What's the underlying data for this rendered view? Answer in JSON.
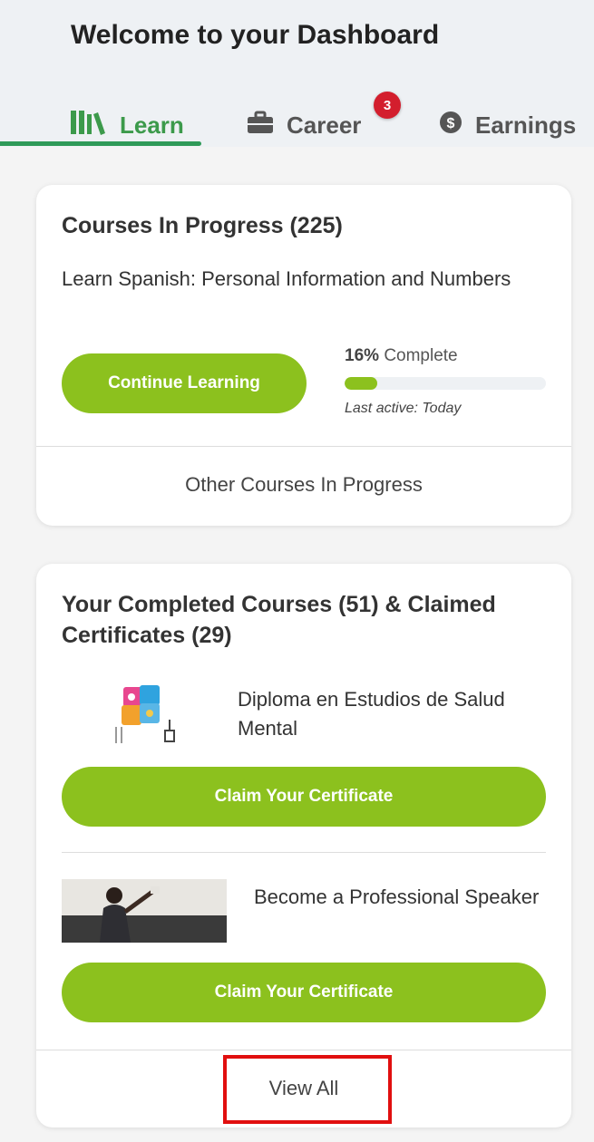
{
  "header": {
    "title": "Welcome to your Dashboard",
    "tabs": [
      {
        "label": "Learn",
        "icon": "books-icon",
        "active": true
      },
      {
        "label": "Career",
        "icon": "briefcase-icon",
        "badge": "3"
      },
      {
        "label": "Earnings",
        "icon": "dollar-coin-icon"
      }
    ]
  },
  "in_progress": {
    "title": "Courses In Progress (225)",
    "course_name": "Learn Spanish: Personal Information and Numbers",
    "continue_label": "Continue Learning",
    "progress_percent": "16%",
    "progress_word": "Complete",
    "progress_value": 0.16,
    "last_active": "Last active: Today",
    "other_link": "Other Courses In Progress"
  },
  "completed": {
    "title": "Your Completed Courses (51) & Claimed Certificates (29)",
    "courses": [
      {
        "name": "Diploma en Estudios de Salud Mental",
        "claim_label": "Claim Your Certificate"
      },
      {
        "name": "Become a Professional Speaker",
        "claim_label": "Claim Your Certificate"
      }
    ],
    "view_all": "View All"
  },
  "colors": {
    "accent_green": "#8cc11e",
    "tab_green": "#3c9a4b",
    "badge_red": "#d31e2d",
    "highlight_red": "#e10f0f"
  }
}
